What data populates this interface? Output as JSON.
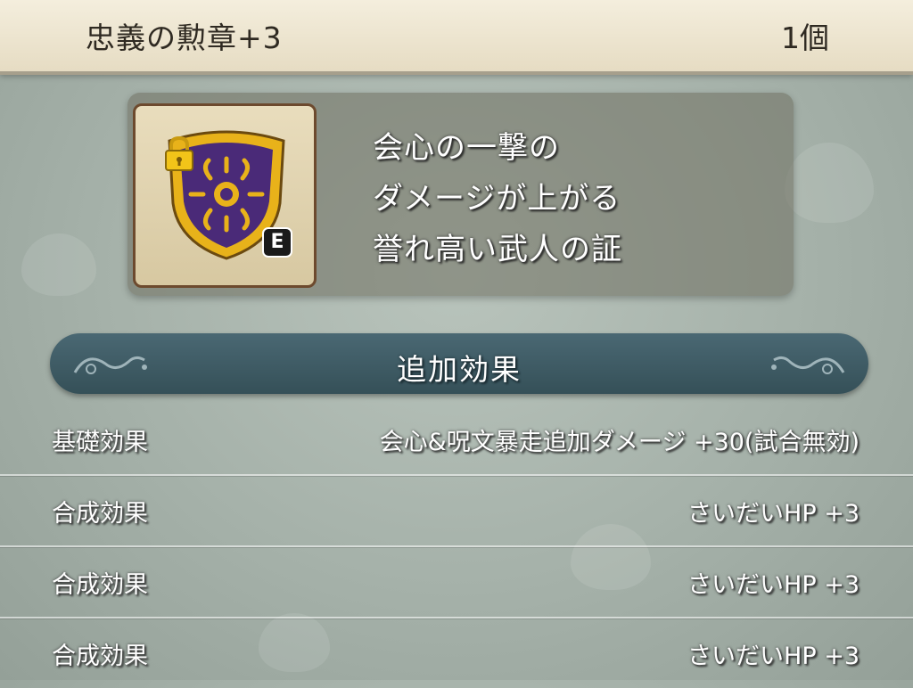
{
  "header": {
    "item_name": "忠義の勲章+3",
    "count": "1個"
  },
  "item": {
    "icon": "purple-shield-medal-icon",
    "lock_icon": "lock-icon",
    "equip_badge": "E",
    "description": [
      "会心の一撃の",
      "ダメージが上がる",
      "誉れ高い武人の証"
    ]
  },
  "section": {
    "title": "追加効果"
  },
  "effects": [
    {
      "label": "基礎効果",
      "value": "会心&呪文暴走追加ダメージ +30(試合無効)"
    },
    {
      "label": "合成効果",
      "value": "さいだいHP +3"
    },
    {
      "label": "合成効果",
      "value": "さいだいHP +3"
    },
    {
      "label": "合成効果",
      "value": "さいだいHP +3"
    }
  ],
  "colors": {
    "header_bg": "#f0e8d4",
    "banner_bg": "#3f5b64",
    "shield_purple": "#4a2a78",
    "shield_gold": "#e8b21a"
  }
}
